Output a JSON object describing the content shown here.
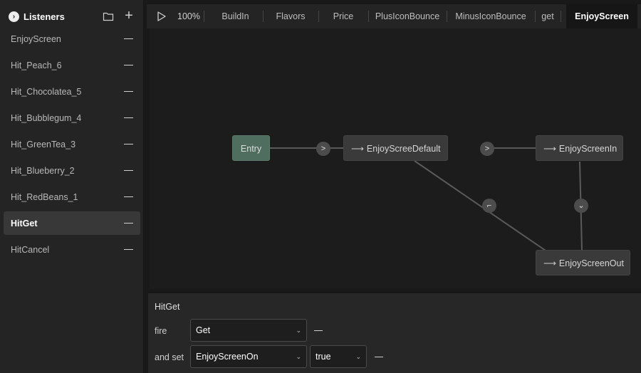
{
  "sidebar": {
    "title": "Listeners",
    "items": [
      {
        "label": "EnjoyScreen",
        "active": false
      },
      {
        "label": "Hit_Peach_6",
        "active": false
      },
      {
        "label": "Hit_Chocolatea_5",
        "active": false
      },
      {
        "label": "Hit_Bubblegum_4",
        "active": false
      },
      {
        "label": "Hit_GreenTea_3",
        "active": false
      },
      {
        "label": "Hit_Blueberry_2",
        "active": false
      },
      {
        "label": "Hit_RedBeans_1",
        "active": false
      },
      {
        "label": "HitGet",
        "active": true
      },
      {
        "label": "HitCancel",
        "active": false
      }
    ]
  },
  "toolbar": {
    "zoom": "100%",
    "tabs": [
      "BuildIn",
      "Flavors",
      "Price",
      "PlusIconBounce",
      "MinusIconBounce",
      "get",
      "EnjoyScreen"
    ],
    "active_tab": "EnjoyScreen"
  },
  "graph": {
    "nodes": {
      "entry": "Entry",
      "default": "EnjoyScreeDefault",
      "in": "EnjoyScreenIn",
      "out": "EnjoyScreenOut"
    },
    "arrow_glyph": "⟶"
  },
  "panel": {
    "title": "HitGet",
    "fire_label": "fire",
    "fire_value": "Get",
    "set_label": "and set",
    "set_param": "EnjoyScreenOn",
    "set_value": "true"
  },
  "colors": {
    "entry_node": "#506e5f",
    "node": "#3a3a3a",
    "active_tab_bg": "#161616"
  }
}
